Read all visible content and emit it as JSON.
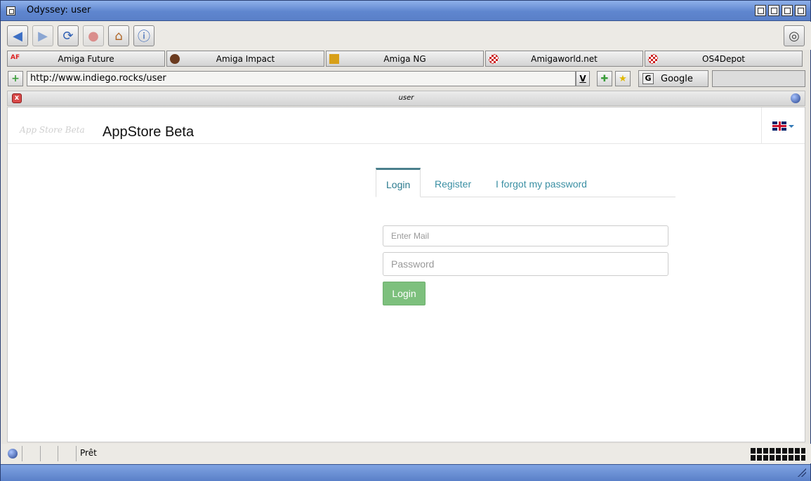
{
  "window": {
    "title": "Odyssey: user"
  },
  "toolbar": {
    "buttons": [
      {
        "name": "back",
        "icon": "arrow-left-icon"
      },
      {
        "name": "forward",
        "icon": "arrow-right-icon"
      },
      {
        "name": "reload",
        "icon": "reload-icon"
      },
      {
        "name": "stop",
        "icon": "stop-icon"
      },
      {
        "name": "home",
        "icon": "home-icon"
      },
      {
        "name": "info",
        "icon": "info-icon"
      }
    ]
  },
  "bookmarks": [
    {
      "label": "Amiga Future",
      "icon_text": "AF"
    },
    {
      "label": "Amiga Impact"
    },
    {
      "label": "Amiga NG"
    },
    {
      "label": "Amigaworld.net"
    },
    {
      "label": "OS4Depot"
    }
  ],
  "address": {
    "url": "http://www.indiego.rocks/user",
    "dropdown_label": "V",
    "search_engine": "Google",
    "search_engine_icon": "G"
  },
  "tab": {
    "title": "user",
    "close_label": "x"
  },
  "page": {
    "logo_text": "App Store Beta",
    "brand": "AppStore Beta",
    "tabs": [
      "Login",
      "Register",
      "I forgot my password"
    ],
    "mail_placeholder": "Enter Mail",
    "password_placeholder": "Password",
    "login_button": "Login",
    "colors": {
      "accent": "#3a8fa3",
      "button": "#7dc07d"
    }
  },
  "status": {
    "text": "Prêt"
  }
}
